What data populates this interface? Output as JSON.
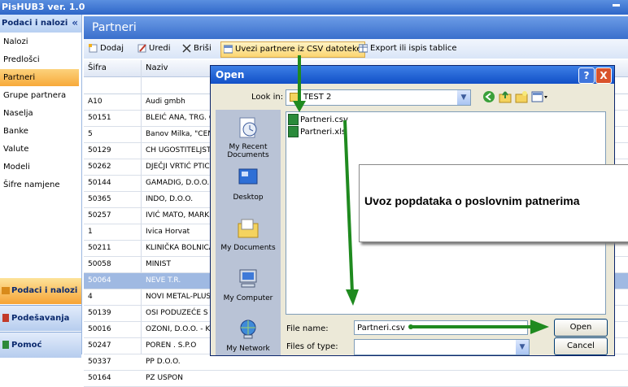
{
  "app": {
    "title": "PisHUB3 ver. 1.0"
  },
  "sidebar": {
    "header": "Podaci i nalozi",
    "collapse": "«",
    "items": [
      {
        "label": "Nalozi"
      },
      {
        "label": "Predlošci"
      },
      {
        "label": "Partneri",
        "selected": true
      },
      {
        "label": "Grupe partnera"
      },
      {
        "label": "Naselja"
      },
      {
        "label": "Banke"
      },
      {
        "label": "Valute"
      },
      {
        "label": "Modeli"
      },
      {
        "label": "Šifre namjene"
      }
    ],
    "bottom": [
      {
        "label": "Podaci i nalozi",
        "selected": true
      },
      {
        "label": "Podešavanja"
      },
      {
        "label": "Pomoć"
      }
    ]
  },
  "main": {
    "title": "Partneri",
    "toolbar": {
      "add": "Dodaj",
      "edit": "Uredi",
      "delete": "Briši",
      "import": "Uvezi partnere iz CSV datoteke",
      "export": "Export ili ispis tablice"
    },
    "columns": [
      "Šifra",
      "Naziv"
    ],
    "rows": [
      {
        "code": "A10",
        "name": "Audi gmbh"
      },
      {
        "code": "50151",
        "name": "BLEIĆ ANA, TRG. O"
      },
      {
        "code": "5",
        "name": "Banov Milka, \"CENT"
      },
      {
        "code": "50129",
        "name": "CH UGOSTITELJSTV"
      },
      {
        "code": "50262",
        "name": "DJEČJI VRTIĆ PTIC"
      },
      {
        "code": "50144",
        "name": "GAMADIG, D.O.O."
      },
      {
        "code": "50365",
        "name": "INDO, D.O.O."
      },
      {
        "code": "50257",
        "name": "IVIĆ MATO, MARKE"
      },
      {
        "code": "1",
        "name": "Ivica Horvat"
      },
      {
        "code": "50211",
        "name": "KLINIČKA BOLNICA"
      },
      {
        "code": "50058",
        "name": "MINIST"
      },
      {
        "code": "50064",
        "name": "NEVE T.R.",
        "selected": true
      },
      {
        "code": "4",
        "name": "NOVI METAL-PLUS,"
      },
      {
        "code": "50139",
        "name": "OSI PODUZEĆE S F"
      },
      {
        "code": "50016",
        "name": "OZONI, D.O.O. - K"
      },
      {
        "code": "50247",
        "name": "POREN . S.P.O"
      },
      {
        "code": "50337",
        "name": "PP D.O.O."
      },
      {
        "code": "50164",
        "name": "PZ USPON"
      }
    ]
  },
  "dialog": {
    "title": "Open",
    "help": "?",
    "close": "X",
    "look_in_label": "Look in:",
    "look_in_value": "TEST 2",
    "places": [
      {
        "label": "My Recent Documents"
      },
      {
        "label": "Desktop"
      },
      {
        "label": "My Documents"
      },
      {
        "label": "My Computer"
      },
      {
        "label": "My Network"
      }
    ],
    "files": [
      {
        "name": "Partneri.csv",
        "selected": true
      },
      {
        "name": "Partneri.xls"
      }
    ],
    "file_name_label": "File name:",
    "file_name_value": "Partneri.csv",
    "file_type_label": "Files of type:",
    "open": "Open",
    "cancel": "Cancel"
  },
  "annotation": {
    "text": "Uvoz popdataka o poslovnim patnerima",
    "arrow_color": "#1f8a1f"
  }
}
